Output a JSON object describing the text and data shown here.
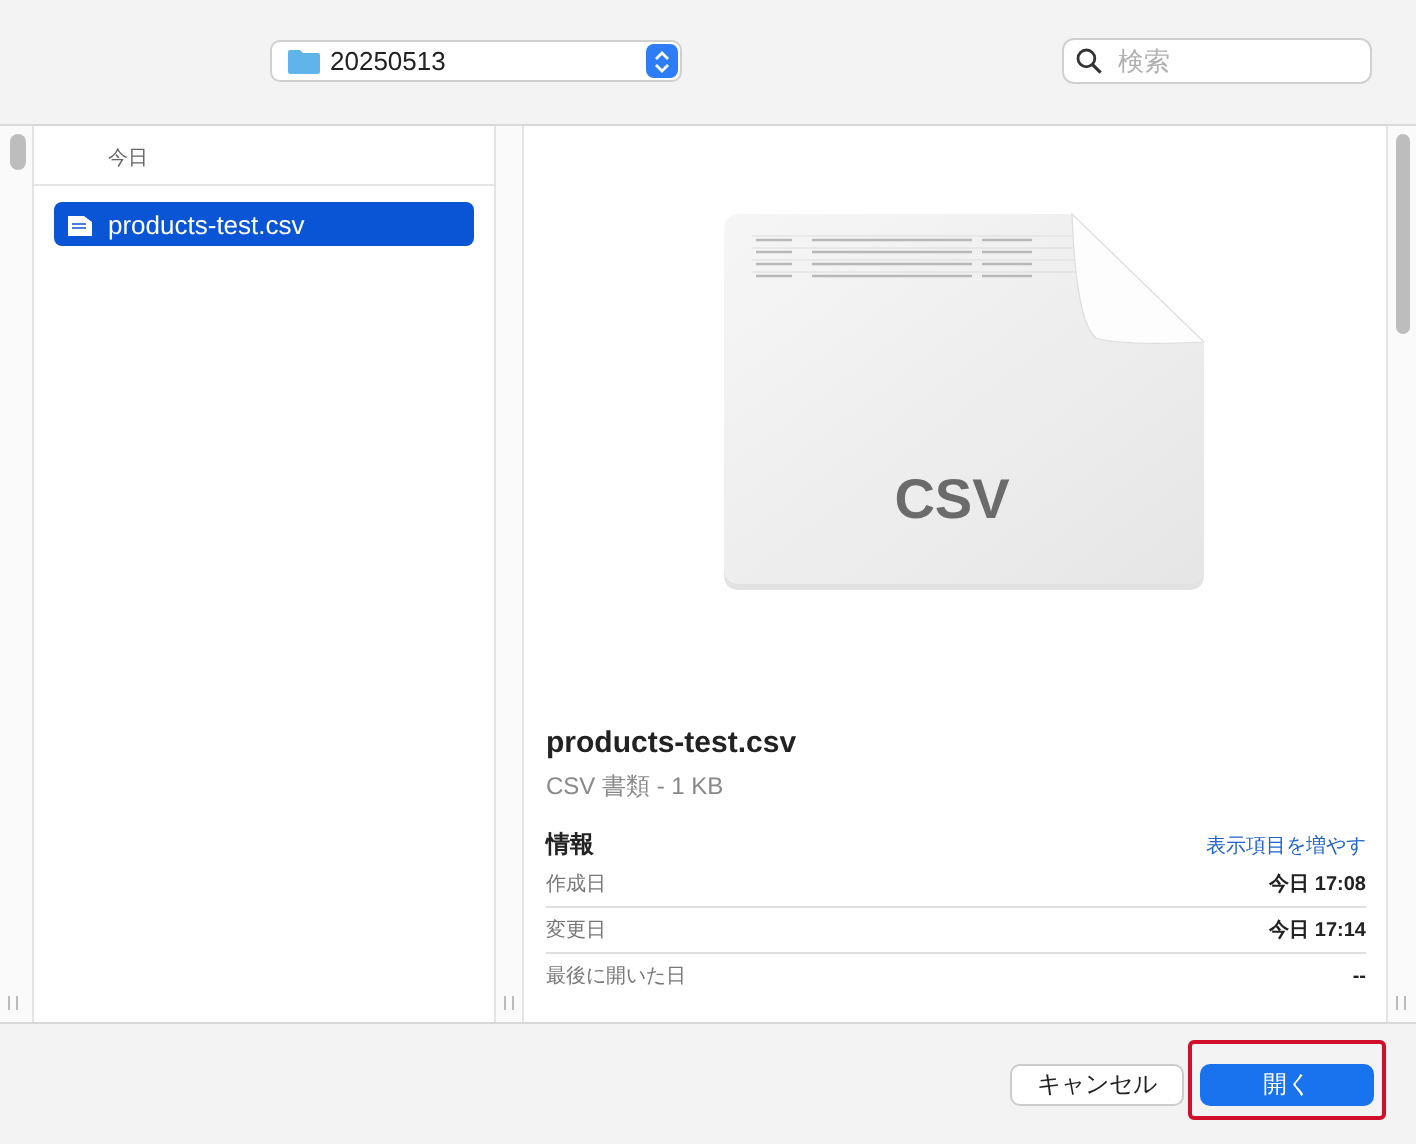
{
  "toolbar": {
    "location": "20250513",
    "search": {
      "placeholder": "検索"
    }
  },
  "file_list": {
    "section": "今日",
    "items": [
      {
        "name": "products-test.csv",
        "selected": true
      }
    ]
  },
  "preview": {
    "icon_label": "CSV",
    "file_name": "products-test.csv",
    "file_kind": "CSV 書類 - 1 KB",
    "info_heading": "情報",
    "more_link": "表示項目を増やす",
    "info_rows": [
      {
        "label": "作成日",
        "value": "今日 17:08"
      },
      {
        "label": "変更日",
        "value": "今日 17:14"
      },
      {
        "label": "最後に開いた日",
        "value": "--"
      }
    ]
  },
  "buttons": [
    {
      "label": "キャンセル",
      "kind": "secondary"
    },
    {
      "label": "開く",
      "kind": "primary"
    }
  ]
}
